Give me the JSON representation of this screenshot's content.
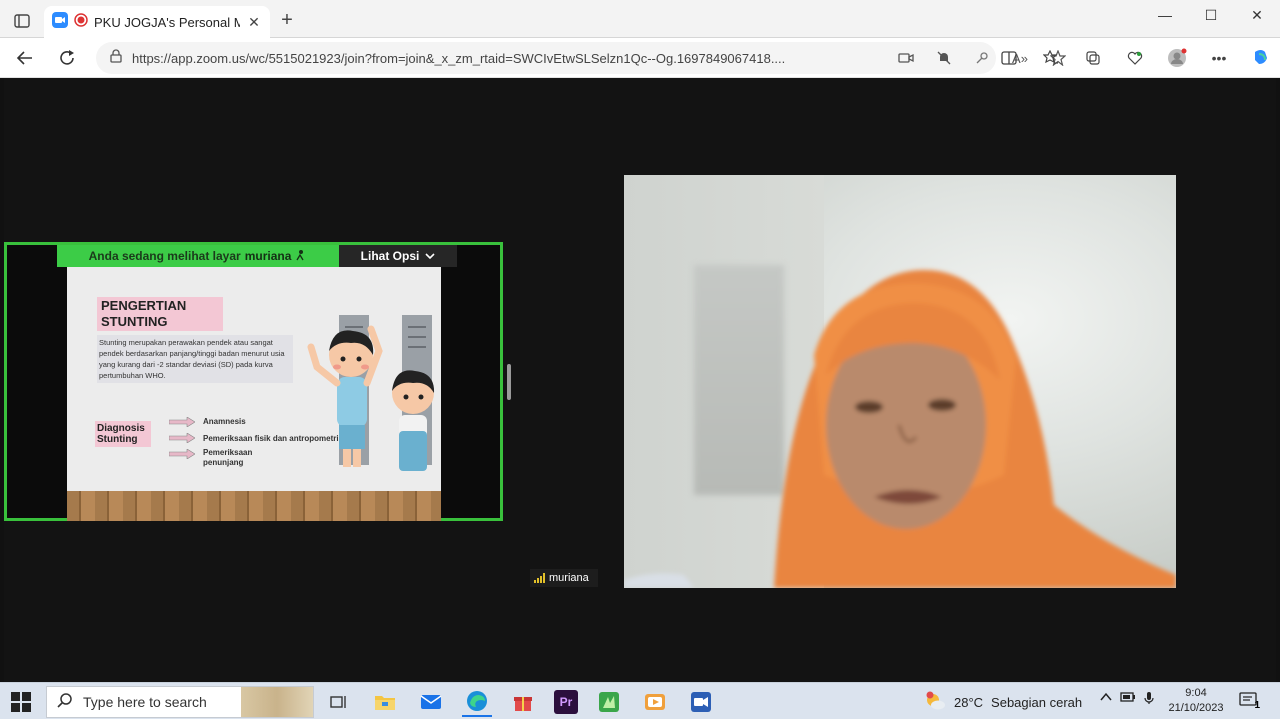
{
  "browser": {
    "tab_title": "PKU JOGJA's Personal Meeti",
    "tab_close": "✕",
    "new_tab": "+",
    "url": "https://app.zoom.us/wc/5515021923/join?from=join&_x_zm_rtaid=SWCIvEtwSLSelzn1Qc--Og.1697849067418....",
    "window_controls": {
      "minimize": "—",
      "maximize": "☐",
      "close": "✕"
    }
  },
  "meeting": {
    "share_banner_prefix": "Anda sedang melihat layar",
    "share_banner_user": "muriana",
    "view_options_label": "Lihat Opsi",
    "participant_name": "muriana"
  },
  "slide": {
    "title": "PENGERTIAN STUNTING",
    "definition": "Stunting merupakan perawakan pendek atau sangat pendek berdasarkan panjang/tinggi badan menurut usia yang kurang dari -2 standar deviasi (SD) pada kurva pertumbuhan WHO.",
    "diagnosis_label": "Diagnosis Stunting",
    "steps": [
      "Anamnesis",
      "Pemeriksaan fisik dan antropometri",
      "Pemeriksaan penunjang"
    ]
  },
  "taskbar": {
    "search_placeholder": "Type here to search",
    "weather_temp": "28°C",
    "weather_desc": "Sebagian cerah",
    "time": "9:04",
    "date": "21/10/2023",
    "notification_count": "1"
  },
  "colors": {
    "share_border": "#39c13c",
    "banner_bg": "#3ccc47",
    "edge_blue": "#1a73e8",
    "hijab_orange": "#e9853f"
  }
}
